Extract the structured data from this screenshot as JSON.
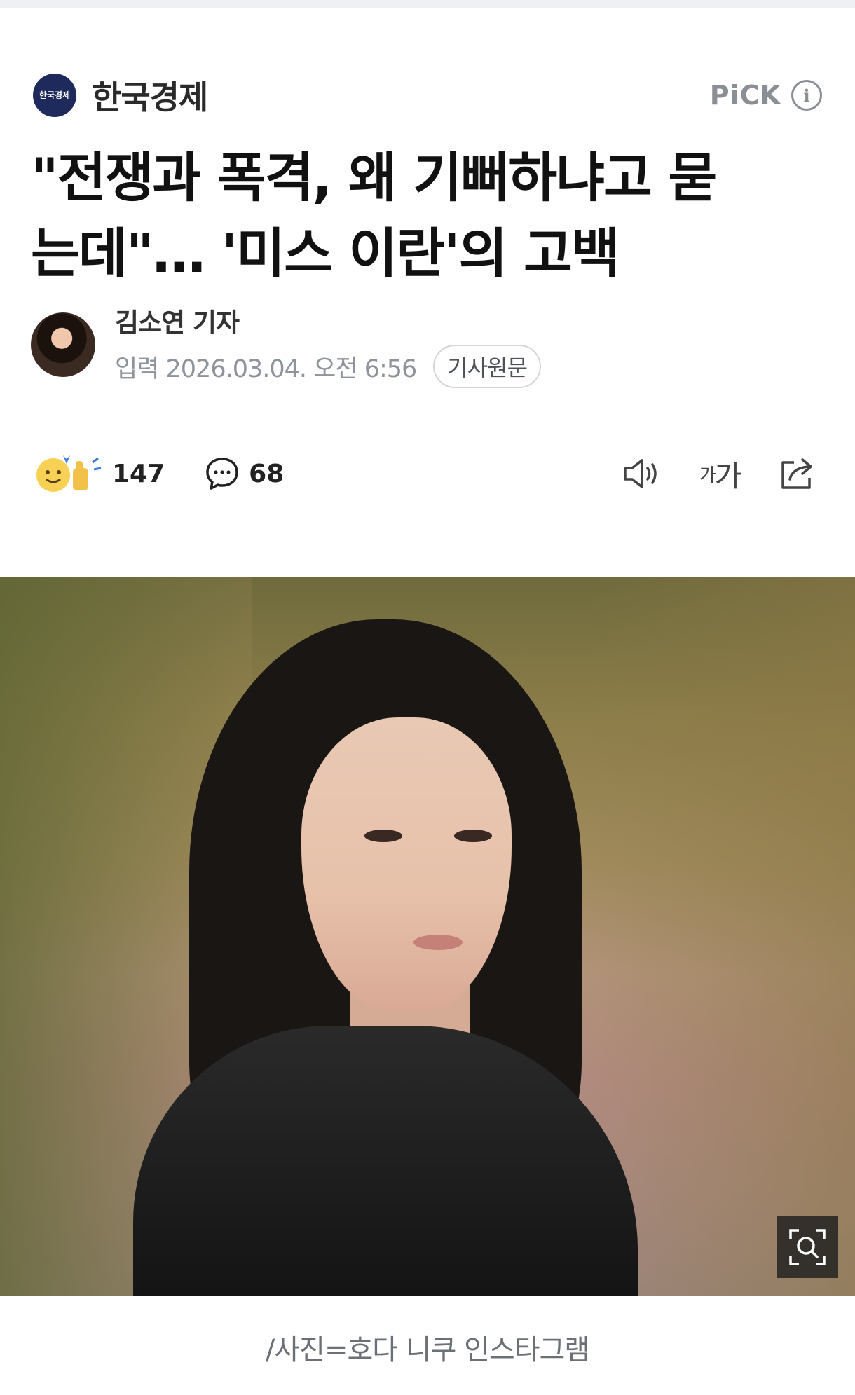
{
  "press": {
    "name": "한국경제",
    "logo_text": "한국경제",
    "pick_label": "PiCK",
    "info_icon": "info-icon"
  },
  "article": {
    "headline_line1": "\"전쟁과 폭격, 왜 기뻐하냐고 묻",
    "headline_line2": "는데\"… '미스 이란'의 고백"
  },
  "reporter": {
    "name": "김소연 기자",
    "date": "입력 2026.03.04. 오전 6:56",
    "origin_button": "기사원문"
  },
  "actions": {
    "reaction_count": "147",
    "comment_count": "68",
    "font_small": "가",
    "font_large": "가"
  },
  "photo": {
    "caption": "/사진=호다 니쿠 인스타그램"
  },
  "colors": {
    "logo_bg": "#1f2a5c",
    "muted": "#8e949b",
    "pick": "#8a8f96"
  }
}
